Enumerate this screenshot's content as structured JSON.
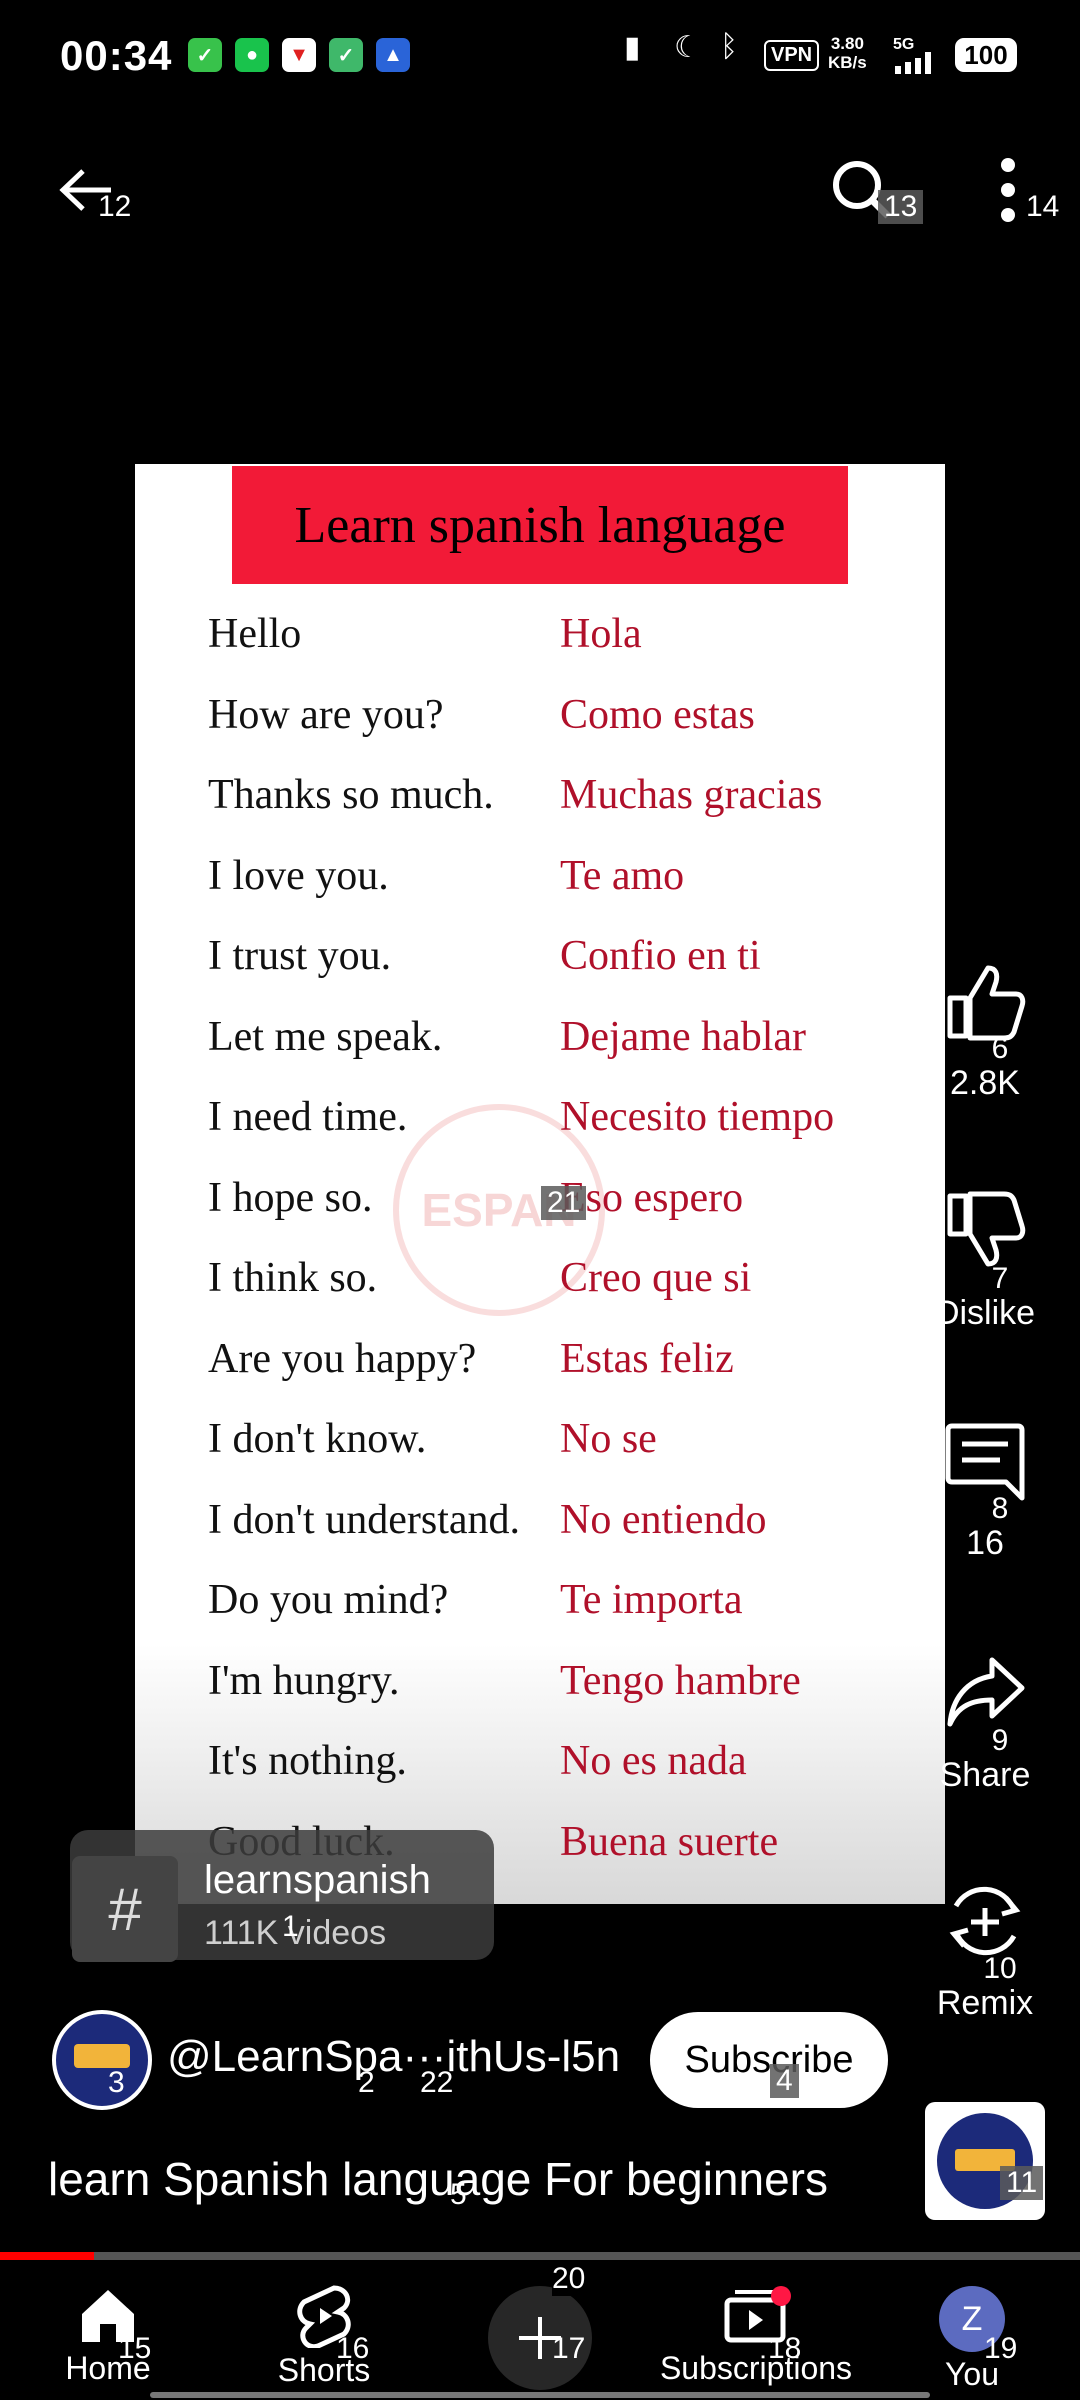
{
  "status_bar": {
    "time": "00:34",
    "vpn": "VPN",
    "speed_value": "3.80",
    "speed_unit": "KB/s",
    "network": "5G",
    "battery": "100"
  },
  "top_bar": {
    "back_marker": "12",
    "search_marker": "13",
    "more_marker": "14"
  },
  "video": {
    "banner_title": "Learn spanish language",
    "phrases": [
      {
        "en": "Hello",
        "es": "Hola"
      },
      {
        "en": "How are you?",
        "es": "Como estas"
      },
      {
        "en": "Thanks so much.",
        "es": "Muchas gracias"
      },
      {
        "en": "I love you.",
        "es": "Te amo"
      },
      {
        "en": "I trust you.",
        "es": "Confio en ti"
      },
      {
        "en": "Let me speak.",
        "es": "Dejame hablar"
      },
      {
        "en": "I need time.",
        "es": "Necesito tiempo"
      },
      {
        "en": "I hope so.",
        "es": "Eso espero"
      },
      {
        "en": "I think so.",
        "es": "Creo que si"
      },
      {
        "en": "Are you happy?",
        "es": "Estas feliz"
      },
      {
        "en": "I don't know.",
        "es": "No se"
      },
      {
        "en": "I don't understand.",
        "es": "No entiendo"
      },
      {
        "en": "Do you mind?",
        "es": "Te importa"
      },
      {
        "en": "I'm hungry.",
        "es": "Tengo hambre"
      },
      {
        "en": "It's nothing.",
        "es": "No es nada"
      },
      {
        "en": "Good luck.",
        "es": "Buena suerte"
      }
    ],
    "watermark": "ESPAN",
    "center_marker": "21"
  },
  "actions": {
    "like": {
      "count": "2.8K",
      "marker": "6"
    },
    "dislike": {
      "label": "Dislike",
      "marker": "7"
    },
    "comments": {
      "count": "16",
      "marker": "8"
    },
    "share": {
      "label": "Share",
      "marker": "9"
    },
    "remix": {
      "label": "Remix",
      "marker": "10"
    }
  },
  "hashtag": {
    "name": "learnspanish",
    "videos": "111K videos",
    "marker": "1"
  },
  "channel": {
    "handle": "@LearnSpa···ithUs-l5n",
    "avatar_marker": "3",
    "marker_a": "2",
    "marker_b": "22",
    "subscribe_label": "Subscribe",
    "subscribe_marker": "4"
  },
  "title": {
    "text": "learn Spanish language For beginners",
    "marker": "5",
    "thumb_marker": "11"
  },
  "progress": {
    "fraction": 0.087
  },
  "nav": {
    "home": {
      "label": "Home",
      "marker": "15"
    },
    "shorts": {
      "label": "Shorts",
      "marker": "16"
    },
    "create": {
      "marker": "17",
      "top_marker": "20"
    },
    "subscriptions": {
      "label": "Subscriptions",
      "marker": "18"
    },
    "you": {
      "label": "You",
      "marker": "19",
      "avatar_letter": "Z"
    }
  },
  "colors": {
    "accent": "#ff0000",
    "banner": "#f21a37",
    "spanish_text": "#b0102a"
  }
}
